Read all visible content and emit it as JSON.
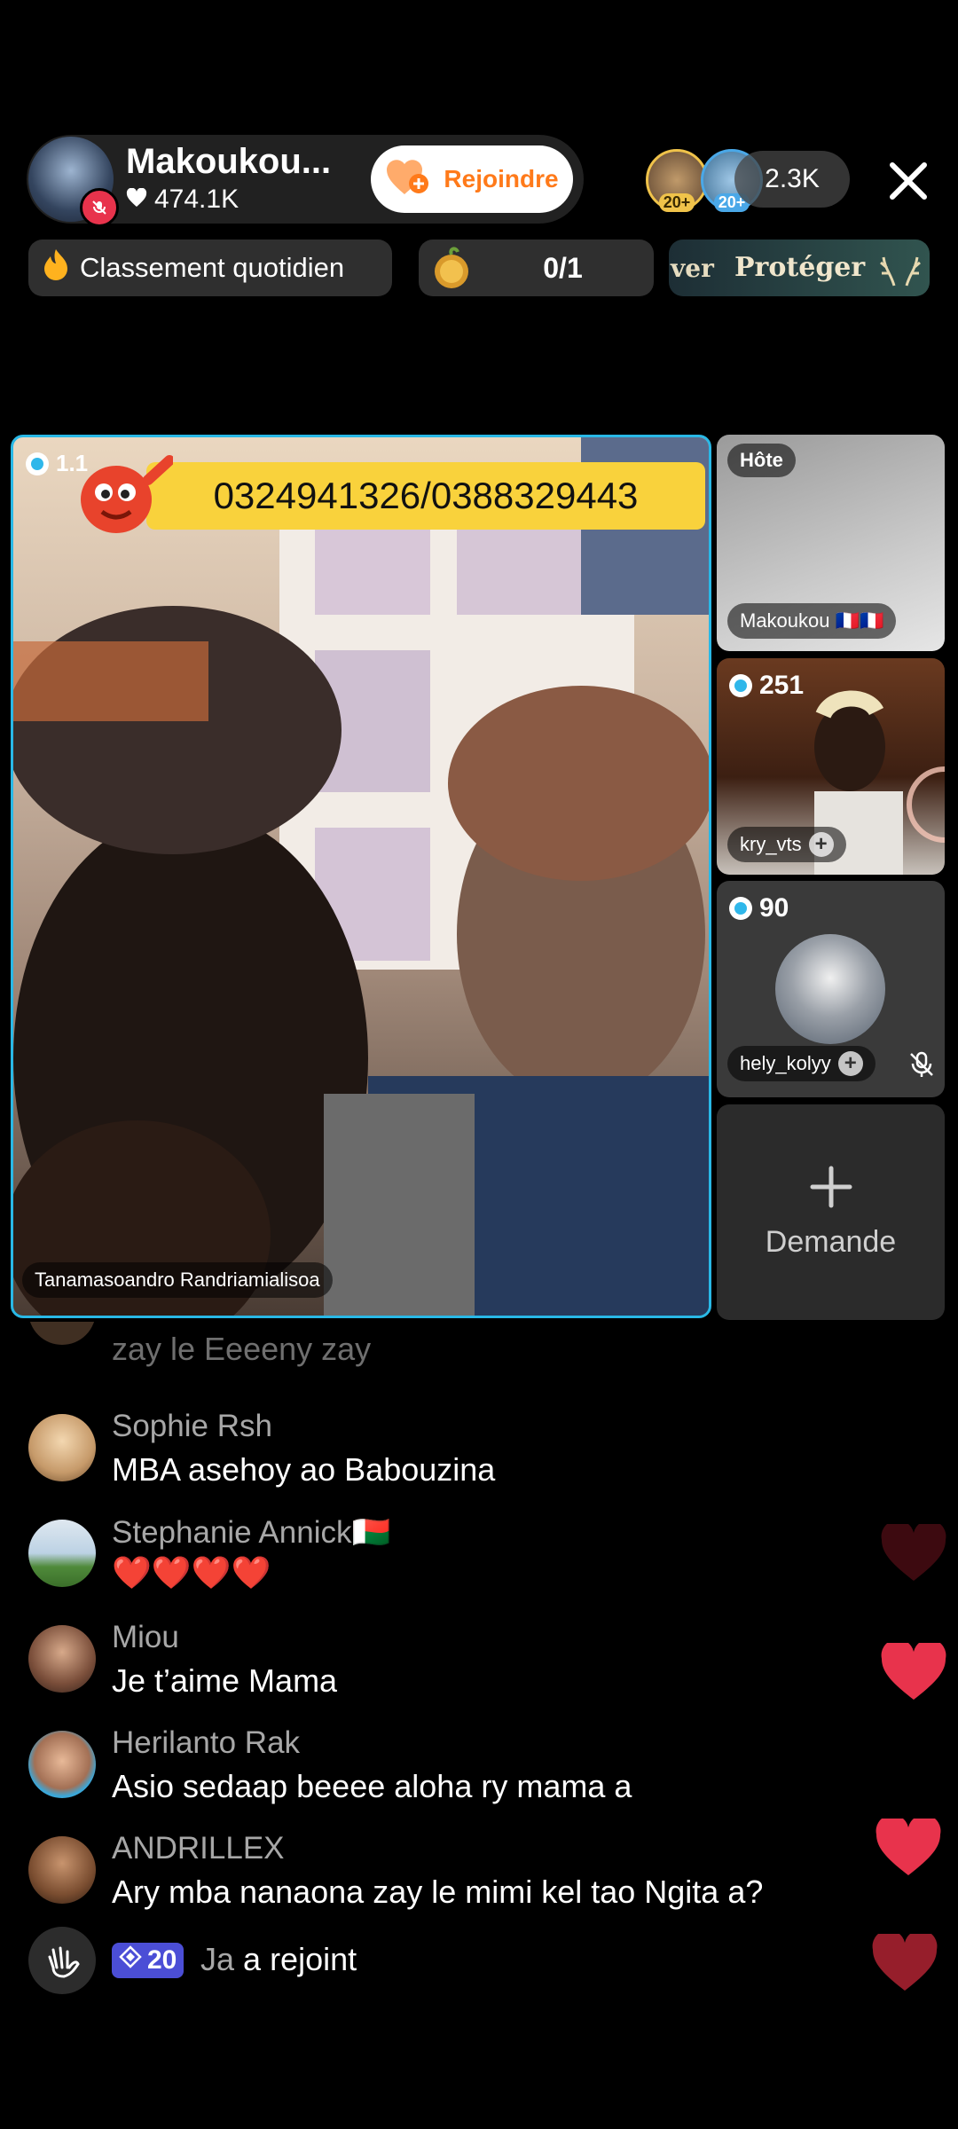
{
  "header": {
    "host_name": "Makoukou...",
    "likes": "474.1K",
    "join_label": "Rejoindre",
    "viewer_badges": [
      "20+",
      "20+"
    ],
    "viewer_count": "2.3K"
  },
  "chips": {
    "ranking_label": "Classement quotidien",
    "goal_progress": "0/1",
    "protect_prefix": "ver",
    "protect_label": "Protéger"
  },
  "main_video": {
    "gem_count": "1.1",
    "banner_text": "0324941326/0388329443",
    "user_name": "Tanamasoandro Randriamialisoa"
  },
  "side_tiles": {
    "host_badge": "Hôte",
    "host_name": "Makoukou 🇫🇷🇫🇷",
    "guest1_gems": "251",
    "guest1_name": "kry_vts",
    "guest2_gems": "90",
    "guest2_name": "hely_kolyy",
    "request_label": "Demande"
  },
  "comments": [
    {
      "name": "",
      "text": "zay le Eeeeny zay"
    },
    {
      "name": "Sophie Rsh",
      "text": "MBA asehoy ao Babouzina"
    },
    {
      "name": "Stephanie Annick🇲🇬",
      "text": "❤️❤️❤️❤️"
    },
    {
      "name": "Miou",
      "text": "Je t’aime Mama"
    },
    {
      "name": "Herilanto Rak",
      "text": "Asio sedaap beeee aloha ry mama a"
    },
    {
      "name": "ANDRILLEX",
      "text": "Ary mba nanaona zay le mimi kel tao Ngita a?"
    }
  ],
  "join_event": {
    "level": "20",
    "user": "Ja",
    "action": "a rejoint"
  },
  "colors": {
    "accent_blue": "#29b8e6",
    "join_orange": "#ff7a1a",
    "heart_red": "#e8334c",
    "banner_yellow": "#f9d23c"
  }
}
